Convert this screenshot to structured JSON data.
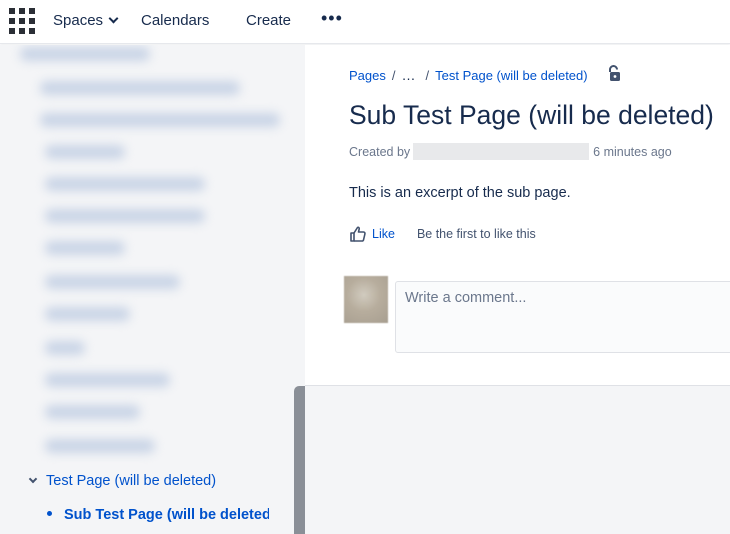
{
  "topnav": {
    "spaces_label": "Spaces",
    "calendars_label": "Calendars",
    "create_label": "Create",
    "more_label": "•••"
  },
  "sidebar": {
    "tree": {
      "parent_label": "Test Page (will be deleted)",
      "child_label": "Sub Test Page (will be deleted)"
    }
  },
  "breadcrumbs": {
    "items": [
      "Pages",
      "…",
      "Test Page (will be deleted)"
    ]
  },
  "page": {
    "title": "Sub Test Page (will be deleted)",
    "byline_prefix": "Created by",
    "byline_time": "6 minutes ago",
    "excerpt": "This is an excerpt of the sub page."
  },
  "likes": {
    "like_label": "Like",
    "hint": "Be the first to like this"
  },
  "comment": {
    "placeholder": "Write a comment..."
  },
  "colors": {
    "link": "#0052cc",
    "text": "#172b4d",
    "sidebar_bg": "#f4f5f7"
  },
  "icons": [
    "app-switcher-icon",
    "chevron-down-icon",
    "more-icon",
    "unlock-icon",
    "thumbs-up-icon",
    "user-avatar"
  ]
}
